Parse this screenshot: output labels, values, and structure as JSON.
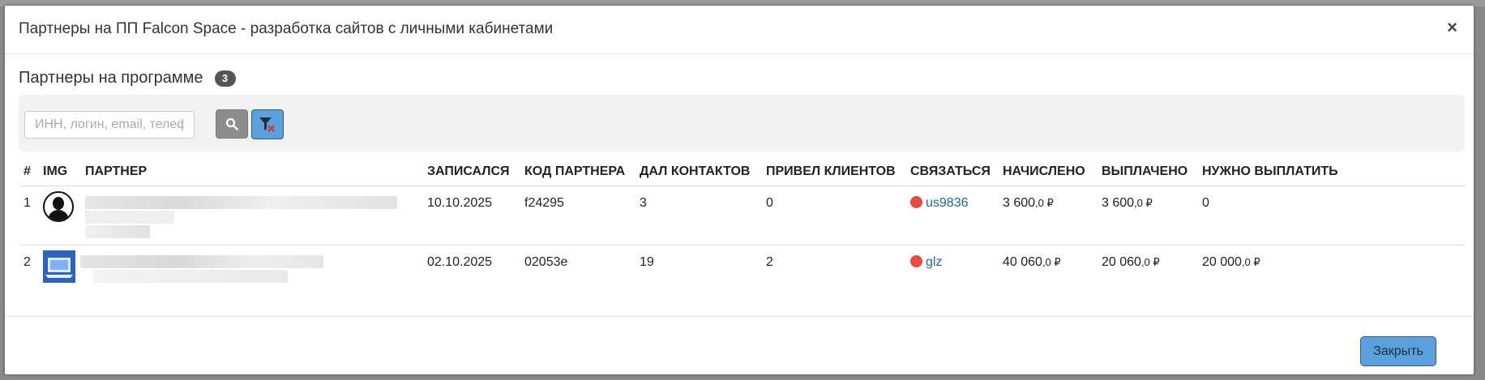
{
  "modal": {
    "title": "Партнеры на ПП Falcon Space - разработка сайтов с личными кабинетами",
    "close_symbol": "×"
  },
  "section": {
    "title": "Партнеры на программе",
    "count": "3"
  },
  "filter": {
    "search_placeholder": "ИНН, логин, email, телефон",
    "search_icon": "search-icon",
    "clear_filter_icon": "filter-clear-icon"
  },
  "table": {
    "headers": [
      "#",
      "IMG",
      "ПАРТНЕР",
      "ЗАПИСАЛСЯ",
      "КОД ПАРТНЕРА",
      "ДАЛ КОНТАКТОВ",
      "ПРИВЕЛ КЛИЕНТОВ",
      "СВЯЗАТЬСЯ",
      "НАЧИСЛЕНО",
      "ВЫПЛАЧЕНО",
      "НУЖНО ВЫПЛАТИТЬ"
    ],
    "rows": [
      {
        "num": "1",
        "img": "person-avatar-icon",
        "date": "10.10.2025",
        "code": "f24295",
        "contacts": "3",
        "clients": "0",
        "contact_login": "us9836",
        "accrued_int": "3 600",
        "accrued_dec": ",0 ₽",
        "paid_int": "3 600",
        "paid_dec": ",0 ₽",
        "to_pay_int": "0",
        "to_pay_dec": ""
      },
      {
        "num": "2",
        "img": "screen-avatar-icon",
        "date": "02.10.2025",
        "code": "02053e",
        "contacts": "19",
        "clients": "2",
        "contact_login": "glz",
        "accrued_int": "40 060",
        "accrued_dec": ",0 ₽",
        "paid_int": "20 060",
        "paid_dec": ",0 ₽",
        "to_pay_int": "20 000",
        "to_pay_dec": ",0 ₽"
      }
    ]
  },
  "footer": {
    "close_label": "Закрыть"
  },
  "colors": {
    "accent_button": "#5aa0dc",
    "money_green": "#2ab37a",
    "link_teal": "#1d6b8a",
    "status_red": "#e84a3f"
  }
}
